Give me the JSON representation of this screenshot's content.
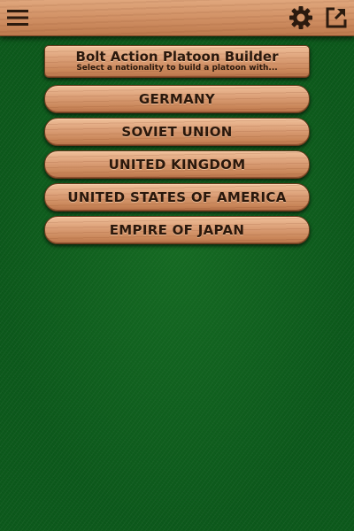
{
  "header": {
    "menu_icon": "hamburger-menu-icon",
    "settings_icon": "gear-icon",
    "share_icon": "share-export-icon"
  },
  "title_plank": {
    "title": "Bolt Action Platoon Builder",
    "subtitle": "Select a nationality to build a platoon with..."
  },
  "nationalities": [
    {
      "label": "GERMANY"
    },
    {
      "label": "SOVIET UNION"
    },
    {
      "label": "UNITED KINGDOM"
    },
    {
      "label": "UNITED STATES OF AMERICA"
    },
    {
      "label": "EMPIRE OF JAPAN"
    }
  ],
  "colors": {
    "felt_green": "#0d5a1c",
    "wood": "#d8996d",
    "text_dark": "#2a180c"
  }
}
